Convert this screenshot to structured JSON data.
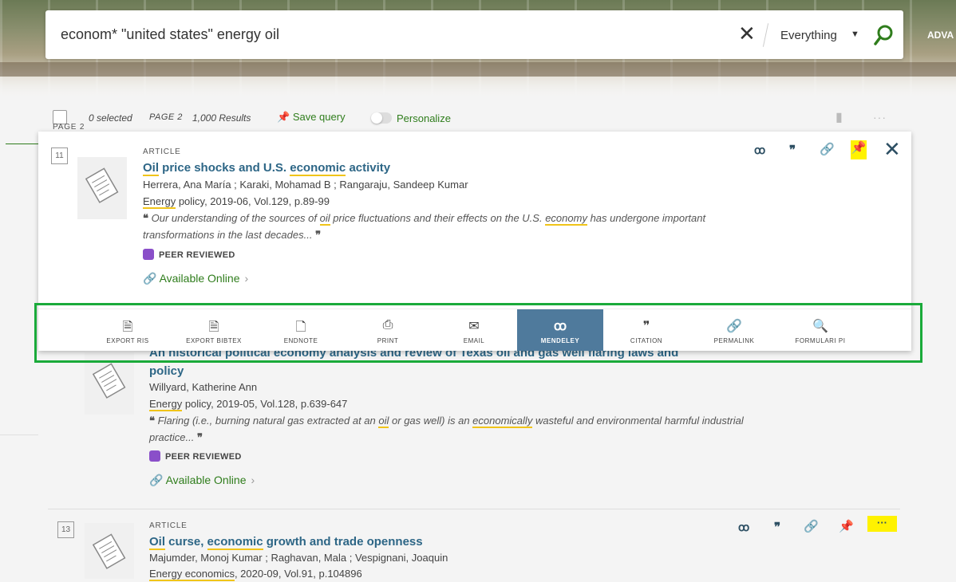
{
  "search": {
    "query": "econom* \"united states\" energy oil",
    "scope": "Everything",
    "advanced_label": "ADVA"
  },
  "toolbar": {
    "selected": "0 selected",
    "page": "PAGE 2",
    "results": "1,000 Results",
    "save_query": "Save query",
    "personalize": "Personalize",
    "more": "···"
  },
  "page_label": "PAGE 2",
  "results": [
    {
      "number": "11",
      "type": "ARTICLE",
      "title_parts": [
        "Oil",
        " price shocks and U.S. ",
        "economic",
        " activity"
      ],
      "authors": "Herrera, Ana María ; Karaki, Mohamad B ; Rangaraju, Sandeep Kumar",
      "source_parts": [
        "Energy",
        " policy, 2019-06, Vol.129, p.89-99"
      ],
      "snippet_line1_parts": [
        " Our understanding of the sources of ",
        "oil",
        " price fluctuations and their effects on the U.S. ",
        "economy",
        " has undergone important"
      ],
      "snippet_line2": "transformations in the last decades...",
      "peer_reviewed": "PEER REVIEWED",
      "availability": "Available Online"
    },
    {
      "title_line1": "An historical political economy analysis and review of Texas oil and gas well flaring laws and",
      "title_line2": "policy",
      "authors": "Willyard, Katherine Ann",
      "source_parts": [
        "Energy",
        " policy, 2019-05, Vol.128, p.639-647"
      ],
      "snippet_line1_parts": [
        " Flaring (i.e., burning natural gas extracted at an ",
        "oil",
        " or gas well) is an ",
        "economically",
        " wasteful and environmental harmful industrial"
      ],
      "snippet_line2": "practice...",
      "peer_reviewed": "PEER REVIEWED",
      "availability": "Available Online"
    },
    {
      "number": "13",
      "type": "ARTICLE",
      "title_parts": [
        "Oil",
        " curse, ",
        "economic",
        " growth and trade openness"
      ],
      "authors": "Majumder, Monoj Kumar ; Raghavan, Mala ; Vespignani, Joaquin",
      "source_parts": [
        "Energy economics",
        ", 2020-09, Vol.91, p.104896"
      ],
      "more": "···"
    }
  ],
  "actions": [
    {
      "label": "EXPORT RIS",
      "icon": "export-ris-icon",
      "glyph": "🗎"
    },
    {
      "label": "EXPORT BIBTEX",
      "icon": "export-bibtex-icon",
      "glyph": "🗎"
    },
    {
      "label": "ENDNOTE",
      "icon": "endnote-icon",
      "glyph": "🗋"
    },
    {
      "label": "PRINT",
      "icon": "print-icon",
      "glyph": "⎙"
    },
    {
      "label": "EMAIL",
      "icon": "email-icon",
      "glyph": "✉"
    },
    {
      "label": "MENDELEY",
      "icon": "mendeley-icon",
      "glyph": "ꝏ"
    },
    {
      "label": "CITATION",
      "icon": "citation-icon",
      "glyph": "❞"
    },
    {
      "label": "PERMALINK",
      "icon": "permalink-icon",
      "glyph": "🔗"
    },
    {
      "label": "FORMULARI PI",
      "icon": "formulari-icon",
      "glyph": "🔍"
    }
  ],
  "colors": {
    "accent_green": "#2f7d1c",
    "title_blue": "#2d6686",
    "active_action": "#4f7a9c",
    "highlight_frame": "#1aaa3a",
    "keyword_underline": "#f0c419",
    "pin_highlight": "#fff200"
  }
}
